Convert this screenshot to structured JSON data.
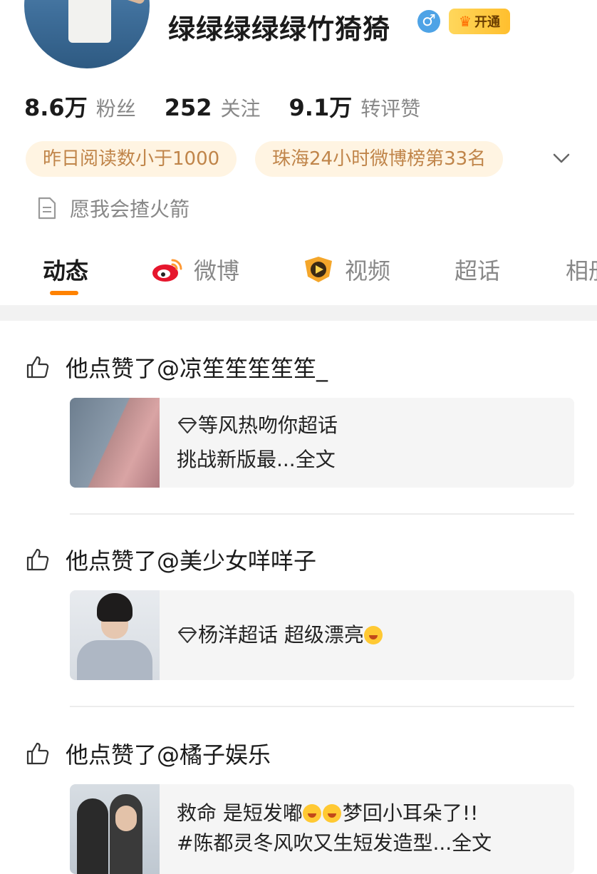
{
  "profile": {
    "name": "绿绿绿绿绿竹猗猗",
    "gender_symbol": "♂",
    "vip_label": "开通",
    "stats": [
      {
        "value": "8.6万",
        "label": "粉丝"
      },
      {
        "value": "252",
        "label": "关注"
      },
      {
        "value": "9.1万",
        "label": "转评赞"
      }
    ],
    "tags": [
      "昨日阅读数小于1000",
      "珠海24小时微博榜第33名"
    ],
    "bio": "愿我会揸火箭"
  },
  "tabs": [
    {
      "label": "动态",
      "active": true
    },
    {
      "label": "微博",
      "active": false
    },
    {
      "label": "视频",
      "active": false
    },
    {
      "label": "超话",
      "active": false
    },
    {
      "label": "相册",
      "active": false
    }
  ],
  "feed": [
    {
      "action": "他点赞了@凉笙笙笙笙笙_",
      "card_lines": [
        "等风热吻你超话",
        "挑战新版最...全文"
      ]
    },
    {
      "action": "他点赞了@美少女咩咩子",
      "card_lines": [
        "杨洋超话  超级漂亮"
      ]
    },
    {
      "action": "他点赞了@橘子娱乐",
      "card_lines": [
        "救命 是短发嘟",
        "梦回小耳朵了!!",
        "#陈都灵冬风吹又生短发造型...全文"
      ]
    }
  ],
  "colors": {
    "accent": "#ff8200",
    "tag_bg": "#fff4e2",
    "tag_text": "#c0854a",
    "card_bg": "#f5f5f5"
  }
}
